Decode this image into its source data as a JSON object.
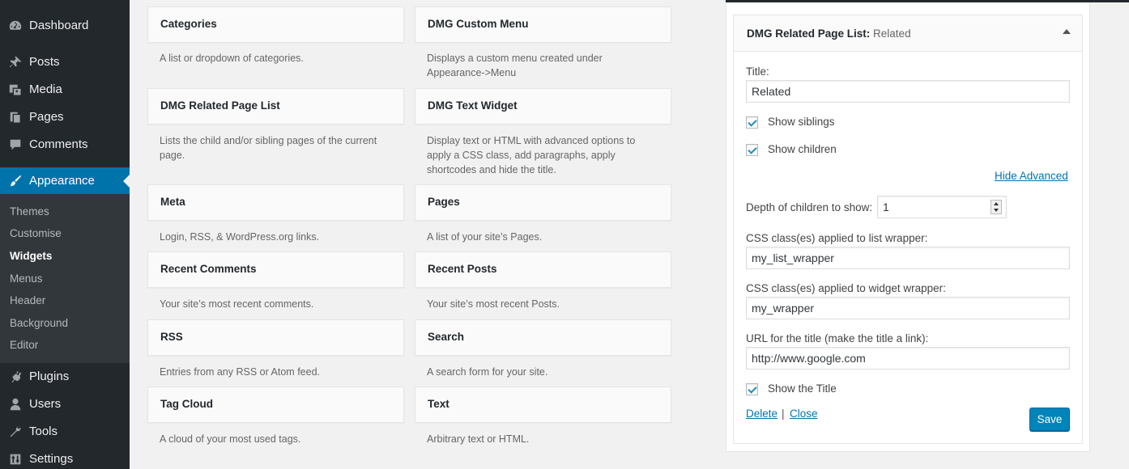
{
  "menu": {
    "dashboard": "Dashboard",
    "posts": "Posts",
    "media": "Media",
    "pages": "Pages",
    "comments": "Comments",
    "appearance": "Appearance",
    "plugins": "Plugins",
    "users": "Users",
    "tools": "Tools",
    "settings": "Settings"
  },
  "submenu": {
    "themes": "Themes",
    "customise": "Customise",
    "widgets": "Widgets",
    "menus": "Menus",
    "header": "Header",
    "background": "Background",
    "editor": "Editor"
  },
  "widgets": [
    {
      "title": "Categories",
      "desc": "A list or dropdown of categories."
    },
    {
      "title": "DMG Custom Menu",
      "desc": "Displays a custom menu created under Appearance->Menu"
    },
    {
      "title": "DMG Related Page List",
      "desc": "Lists the child and/or sibling pages of the current page."
    },
    {
      "title": "DMG Text Widget",
      "desc": "Display text or HTML with advanced options to apply a CSS class, add paragraphs, apply shortcodes and hide the title."
    },
    {
      "title": "Meta",
      "desc": "Login, RSS, & WordPress.org links."
    },
    {
      "title": "Pages",
      "desc": "A list of your site’s Pages."
    },
    {
      "title": "Recent Comments",
      "desc": "Your site’s most recent comments."
    },
    {
      "title": "Recent Posts",
      "desc": "Your site’s most recent Posts."
    },
    {
      "title": "RSS",
      "desc": "Entries from any RSS or Atom feed."
    },
    {
      "title": "Search",
      "desc": "A search form for your site."
    },
    {
      "title": "Tag Cloud",
      "desc": "A cloud of your most used tags."
    },
    {
      "title": "Text",
      "desc": "Arbitrary text or HTML."
    }
  ],
  "open_widget": {
    "name": "DMG Related Page List:",
    "instance_title": "Related",
    "title_label": "Title:",
    "title_value": "Related",
    "show_siblings": "Show siblings",
    "show_children": "Show children",
    "hide_advanced": "Hide Advanced",
    "depth_label": "Depth of children to show:",
    "depth_value": "1",
    "list_wrapper_label": "CSS class(es) applied to list wrapper:",
    "list_wrapper_value": "my_list_wrapper",
    "widget_wrapper_label": "CSS class(es) applied to widget wrapper:",
    "widget_wrapper_value": "my_wrapper",
    "url_label": "URL for the title (make the title a link):",
    "url_value": "http://www.google.com",
    "show_title": "Show the Title",
    "delete": "Delete",
    "separator": "|",
    "close": "Close",
    "save": "Save"
  },
  "icons": {
    "dashboard": "dashboard-icon",
    "posts": "pin-icon",
    "media": "media-icon",
    "pages": "pages-icon",
    "comments": "comment-icon",
    "appearance": "brush-icon",
    "plugins": "plugin-icon",
    "users": "user-icon",
    "tools": "wrench-icon",
    "settings": "settings-icon"
  },
  "colors": {
    "accent": "#0073aa",
    "sidebar": "#23282d",
    "submenu": "#32373c",
    "save_button": "#0085ba"
  }
}
